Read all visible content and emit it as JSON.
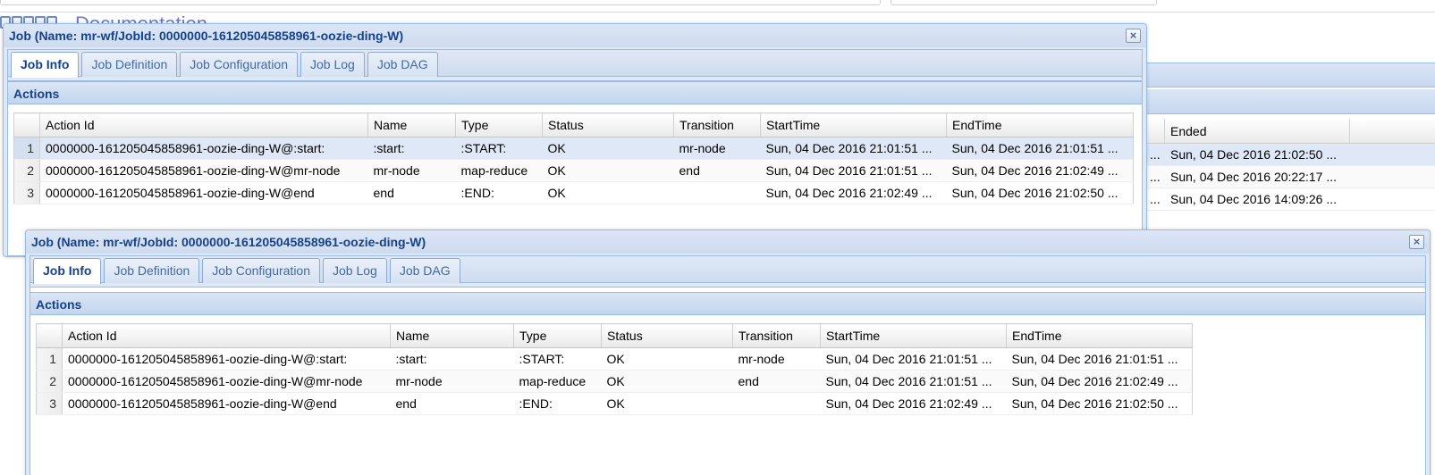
{
  "background": {
    "doc_link": "Documentation",
    "grid_headers": [
      "",
      "Ended"
    ],
    "grid_rows": [
      [
        "...",
        "Sun, 04 Dec 2016 21:02:50 ..."
      ],
      [
        "...",
        "Sun, 04 Dec 2016 20:22:17 ..."
      ],
      [
        "...",
        "Sun, 04 Dec 2016 14:09:26 ..."
      ]
    ]
  },
  "windows": [
    {
      "title": "Job (Name: mr-wf/JobId: 0000000-161205045858961-oozie-ding-W)",
      "close_glyph": "×"
    },
    {
      "title": "Job (Name: mr-wf/JobId: 0000000-161205045858961-oozie-ding-W)",
      "close_glyph": "×"
    }
  ],
  "tabs": [
    "Job Info",
    "Job Definition",
    "Job Configuration",
    "Job Log",
    "Job DAG"
  ],
  "actions_title": "Actions",
  "columns": [
    "Action Id",
    "Name",
    "Type",
    "Status",
    "Transition",
    "StartTime",
    "EndTime"
  ],
  "rows": [
    {
      "num": "1",
      "action_id": "0000000-161205045858961-oozie-ding-W@:start:",
      "name": ":start:",
      "type": ":START:",
      "status": "OK",
      "transition": "mr-node",
      "start": "Sun, 04 Dec 2016 21:01:51 ...",
      "end": "Sun, 04 Dec 2016 21:01:51 ..."
    },
    {
      "num": "2",
      "action_id": "0000000-161205045858961-oozie-ding-W@mr-node",
      "name": "mr-node",
      "type": "map-reduce",
      "status": "OK",
      "transition": "end",
      "start": "Sun, 04 Dec 2016 21:01:51 ...",
      "end": "Sun, 04 Dec 2016 21:02:49 ..."
    },
    {
      "num": "3",
      "action_id": "0000000-161205045858961-oozie-ding-W@end",
      "name": "end",
      "type": ":END:",
      "status": "OK",
      "transition": "",
      "start": "Sun, 04 Dec 2016 21:02:49 ...",
      "end": "Sun, 04 Dec 2016 21:02:50 ..."
    }
  ],
  "colors": {
    "title_text": "#15428b",
    "frame_border": "#99bbe8",
    "header_fill": "#dfe8f6",
    "selected_row": "#dfe8f6"
  }
}
